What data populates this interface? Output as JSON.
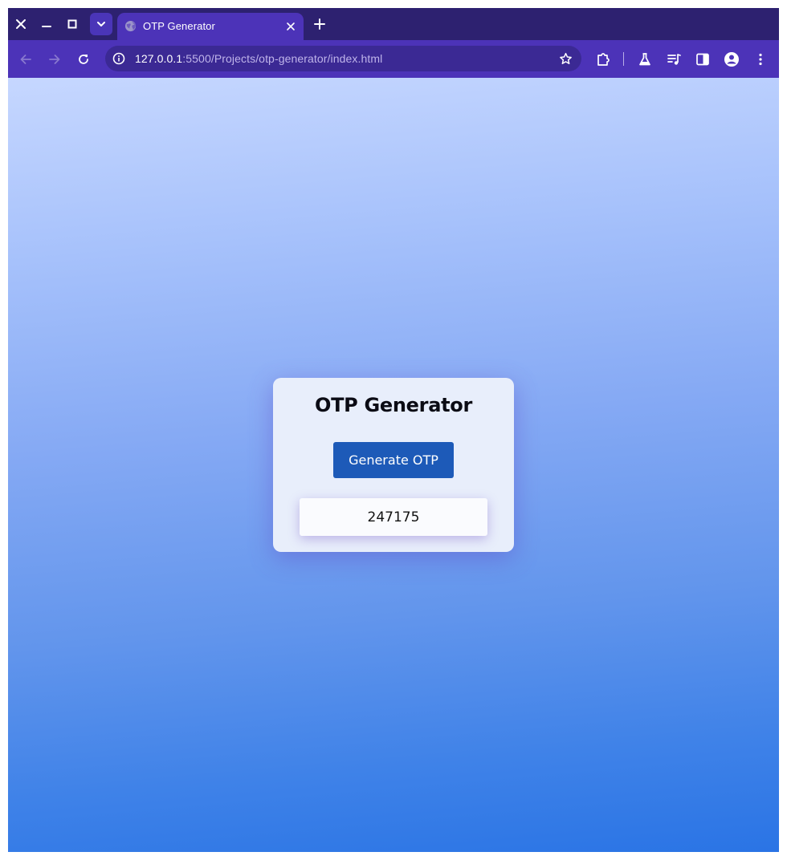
{
  "browser": {
    "tab": {
      "title": "OTP Generator"
    },
    "address_bar": {
      "host": "127.0.0.1",
      "path": ":5500/Projects/otp-generator/index.html"
    },
    "icons": {
      "window_close": "close-icon",
      "minimize": "minimize-icon",
      "maximize": "maximize-icon",
      "tab_search": "chevron-down-icon",
      "tab_favicon": "globe-icon",
      "tab_close": "close-icon",
      "new_tab": "plus-icon",
      "back": "arrow-left-icon",
      "forward": "arrow-right-icon",
      "reload": "reload-icon",
      "site_info": "info-icon",
      "bookmark": "star-icon",
      "extensions": "puzzle-icon",
      "labs": "flask-icon",
      "media": "media-queue-icon",
      "side_panel": "side-panel-icon",
      "profile": "profile-icon",
      "menu": "kebab-menu-icon"
    },
    "colors": {
      "tabstrip": "#2d2170",
      "active_tab": "#4c33b8",
      "omnibox": "#3b2994"
    }
  },
  "page": {
    "card": {
      "title": "OTP Generator",
      "button_label": "Generate OTP",
      "otp_value": "247175"
    },
    "colors": {
      "button": "#1d5ab8",
      "card": "#e8eefb",
      "gradient_top": "#c6d7ff",
      "gradient_bottom": "#2a74e5"
    }
  }
}
